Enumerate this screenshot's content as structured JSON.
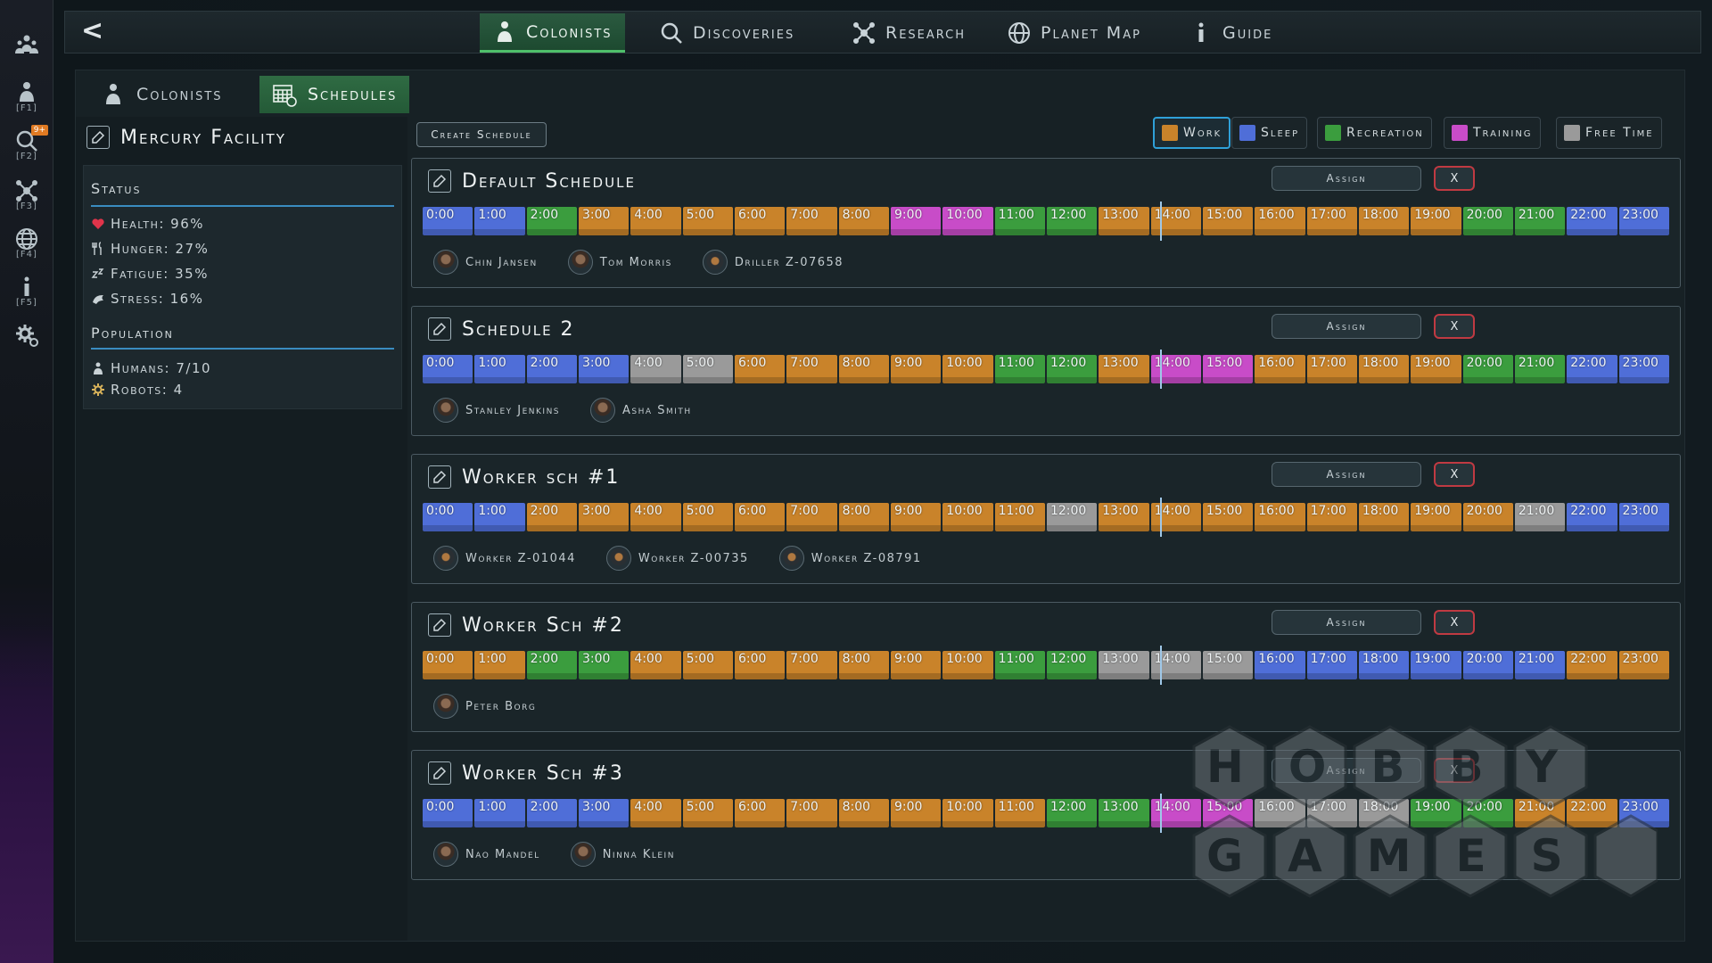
{
  "colors": {
    "work": "#c9832a",
    "sleep": "#4f6ed8",
    "recreation": "#3b9d3e",
    "training": "#c84cc8",
    "free_time": "#9a9a9a",
    "accent": "#2fa0d8",
    "active_tab": "#2f6b43"
  },
  "leftbar": [
    {
      "name": "colonies-icon",
      "key": ""
    },
    {
      "name": "colonists-icon",
      "key": "[F1]"
    },
    {
      "name": "discoveries-icon",
      "key": "[F2]",
      "badge": "9+"
    },
    {
      "name": "research-icon",
      "key": "[F3]"
    },
    {
      "name": "planet-map-icon",
      "key": "[F4]"
    },
    {
      "name": "guide-icon",
      "key": "[F5]"
    },
    {
      "name": "settings-icon",
      "key": ""
    }
  ],
  "topnav": {
    "back": "<",
    "tabs": [
      {
        "label": "Colonists",
        "icon": "colonists-icon",
        "active": true
      },
      {
        "label": "Discoveries",
        "icon": "discoveries-icon"
      },
      {
        "label": "Research",
        "icon": "research-icon"
      },
      {
        "label": "Planet Map",
        "icon": "planet-map-icon"
      },
      {
        "label": "Guide",
        "icon": "guide-icon"
      }
    ]
  },
  "subtabs": [
    {
      "label": "Colonists",
      "icon": "colonists-icon"
    },
    {
      "label": "Schedules",
      "icon": "schedules-icon",
      "active": true
    }
  ],
  "facility": {
    "title": "Mercury Facility",
    "status_title": "Status",
    "health": "Health: 96%",
    "hunger": "Hunger: 27%",
    "fatigue": "Fatigue: 35%",
    "stress": "Stress: 16%",
    "population_title": "Population",
    "humans": "Humans: 7/10",
    "robots": "Robots: 4"
  },
  "toolbar": {
    "create_label": "Create Schedule"
  },
  "legend": [
    {
      "label": "Work",
      "key": "work",
      "selected": true
    },
    {
      "label": "Sleep",
      "key": "sleep"
    },
    {
      "label": "Recreation",
      "key": "recreation"
    },
    {
      "label": "Training",
      "key": "training"
    },
    {
      "label": "Free Time",
      "key": "free_time"
    }
  ],
  "assign_label": "Assign",
  "delete_label": "X",
  "hours": [
    "0:00",
    "1:00",
    "2:00",
    "3:00",
    "4:00",
    "5:00",
    "6:00",
    "7:00",
    "8:00",
    "9:00",
    "10:00",
    "11:00",
    "12:00",
    "13:00",
    "14:00",
    "15:00",
    "16:00",
    "17:00",
    "18:00",
    "19:00",
    "20:00",
    "21:00",
    "22:00",
    "23:00"
  ],
  "current_hour": 14,
  "schedules": [
    {
      "title": "Default Schedule",
      "activities": [
        "sleep",
        "sleep",
        "recreation",
        "work",
        "work",
        "work",
        "work",
        "work",
        "work",
        "training",
        "training",
        "recreation",
        "recreation",
        "work",
        "work",
        "work",
        "work",
        "work",
        "work",
        "work",
        "recreation",
        "recreation",
        "sleep",
        "sleep"
      ],
      "members": [
        {
          "name": "Chin Jansen",
          "type": "human"
        },
        {
          "name": "Tom Morris",
          "type": "human"
        },
        {
          "name": "Driller Z-07658",
          "type": "robot"
        }
      ]
    },
    {
      "title": "Schedule 2",
      "activities": [
        "sleep",
        "sleep",
        "sleep",
        "sleep",
        "free_time",
        "free_time",
        "work",
        "work",
        "work",
        "work",
        "work",
        "recreation",
        "recreation",
        "work",
        "training",
        "training",
        "work",
        "work",
        "work",
        "work",
        "recreation",
        "recreation",
        "sleep",
        "sleep"
      ],
      "members": [
        {
          "name": "Stanley Jenkins",
          "type": "human"
        },
        {
          "name": "Asha Smith",
          "type": "human"
        }
      ]
    },
    {
      "title": "Worker sch #1",
      "activities": [
        "sleep",
        "sleep",
        "work",
        "work",
        "work",
        "work",
        "work",
        "work",
        "work",
        "work",
        "work",
        "work",
        "free_time",
        "work",
        "work",
        "work",
        "work",
        "work",
        "work",
        "work",
        "work",
        "free_time",
        "sleep",
        "sleep"
      ],
      "members": [
        {
          "name": "Worker Z-01044",
          "type": "robot"
        },
        {
          "name": "Worker Z-00735",
          "type": "robot"
        },
        {
          "name": "Worker Z-08791",
          "type": "robot"
        }
      ]
    },
    {
      "title": "Worker Sch #2",
      "activities": [
        "work",
        "work",
        "recreation",
        "recreation",
        "work",
        "work",
        "work",
        "work",
        "work",
        "work",
        "work",
        "recreation",
        "recreation",
        "free_time",
        "free_time",
        "free_time",
        "sleep",
        "sleep",
        "sleep",
        "sleep",
        "sleep",
        "sleep",
        "work",
        "work"
      ],
      "members": [
        {
          "name": "Peter Borg",
          "type": "human"
        }
      ]
    },
    {
      "title": "Worker Sch #3",
      "activities": [
        "sleep",
        "sleep",
        "sleep",
        "sleep",
        "work",
        "work",
        "work",
        "work",
        "work",
        "work",
        "work",
        "work",
        "recreation",
        "recreation",
        "training",
        "training",
        "free_time",
        "free_time",
        "free_time",
        "recreation",
        "recreation",
        "work",
        "work",
        "sleep"
      ],
      "members": [
        {
          "name": "Nao Mandel",
          "type": "human"
        },
        {
          "name": "Ninna Klein",
          "type": "human"
        }
      ]
    }
  ],
  "watermark": {
    "line1": "HOBBY",
    "line2": "GAMES"
  }
}
